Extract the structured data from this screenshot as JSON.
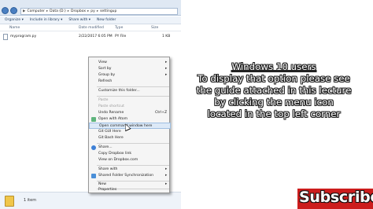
{
  "explorer": {
    "breadcrumb": [
      "Computer",
      "Data (D:)",
      "Dropbox",
      "py",
      "settingup"
    ],
    "toolbar": [
      "Organize ▾",
      "Include in library ▾",
      "Share with ▾",
      "New folder"
    ],
    "columns": {
      "name": "Name",
      "date": "Date modified",
      "type": "Type",
      "size": "Size"
    },
    "files": [
      {
        "name": "myprogram.py",
        "date": "2/22/2017 6:05 PM",
        "type": "PY File",
        "size": "1 KB"
      }
    ],
    "status": "1 item"
  },
  "context_menu": {
    "items": [
      {
        "label": "View",
        "arrow": "▸"
      },
      {
        "label": "Sort by",
        "arrow": "▸"
      },
      {
        "label": "Group by",
        "arrow": "▸"
      },
      {
        "label": "Refresh"
      },
      {
        "label": "Customize this folder..."
      },
      {
        "label": "Paste",
        "disabled": true
      },
      {
        "label": "Paste shortcut",
        "disabled": true
      },
      {
        "label": "Undo Rename",
        "shortcut": "Ctrl+Z"
      },
      {
        "label": "Open with Atom"
      },
      {
        "label": "Open command window here",
        "highlighted": true
      },
      {
        "label": "Git GUI Here"
      },
      {
        "label": "Git Bash Here"
      },
      {
        "label": "Share..."
      },
      {
        "label": "Copy Dropbox link"
      },
      {
        "label": "View on Dropbox.com"
      },
      {
        "label": "Share with",
        "arrow": "▸"
      },
      {
        "label": "Shared Folder Synchronization",
        "arrow": "▸"
      },
      {
        "label": "New",
        "arrow": "▸"
      },
      {
        "label": "Properties"
      }
    ]
  },
  "overlay": {
    "lines": [
      "Windows 10 users",
      "To display that option please see",
      "the guide attached in this lecture",
      "by clicking the menu icon",
      "located in the top left corner"
    ]
  },
  "subscribe": {
    "label": "Subscribe"
  },
  "colors": {
    "menu_highlight": "#dce9f7",
    "subscribe_bg": "#cc1d1d",
    "window_chrome": "#dfe8f3"
  }
}
